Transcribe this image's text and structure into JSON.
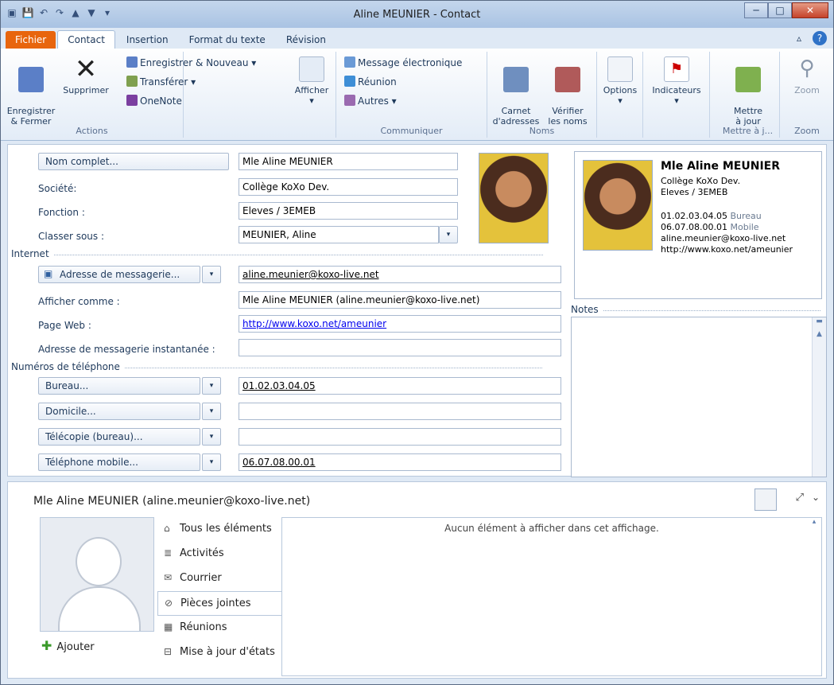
{
  "window": {
    "title": "Aline MEUNIER  -  Contact"
  },
  "tabs": [
    "Fichier",
    "Contact",
    "Insertion",
    "Format du texte",
    "Révision"
  ],
  "ribbon": {
    "actions": {
      "save_close": "Enregistrer\n& Fermer",
      "delete": "Supprimer",
      "save_new": "Enregistrer & Nouveau ▾",
      "forward": "Transférer ▾",
      "onenote": "OneNote",
      "label": "Actions"
    },
    "show": {
      "label": "Afficher"
    },
    "communicate": {
      "email": "Message électronique",
      "meeting": "Réunion",
      "more": "Autres ▾",
      "label": "Communiquer"
    },
    "names": {
      "address_book": "Carnet\nd'adresses",
      "check_names": "Vérifier\nles noms",
      "label": "Noms"
    },
    "options": {
      "label": "Options"
    },
    "flags": {
      "label": "Indicateurs"
    },
    "update": {
      "button": "Mettre\nà jour",
      "label": "Mettre à j..."
    },
    "zoom": {
      "button": "Zoom",
      "label": "Zoom"
    }
  },
  "form": {
    "fullname_btn": "Nom complet...",
    "fullname": "Mle Aline MEUNIER",
    "company_lbl": "Société:",
    "company": "Collège KoXo Dev.",
    "job_lbl": "Fonction :",
    "job": "Eleves / 3EMEB",
    "fileas_lbl": "Classer sous :",
    "fileas": "MEUNIER, Aline",
    "internet": "Internet",
    "email_btn": "Adresse de messagerie...",
    "email": "aline.meunier@koxo-live.net",
    "display_lbl": "Afficher comme :",
    "display": "Mle Aline MEUNIER (aline.meunier@koxo-live.net)",
    "web_lbl": "Page Web :",
    "web": "http://www.koxo.net/ameunier",
    "im_lbl": "Adresse de messagerie instantanée :",
    "im": "",
    "phones": "Numéros de téléphone",
    "business_btn": "Bureau...",
    "business": "01.02.03.04.05",
    "home_btn": "Domicile...",
    "home": "",
    "fax_btn": "Télécopie (bureau)...",
    "fax": "",
    "mobile_btn": "Téléphone mobile...",
    "mobile": "06.07.08.00.01",
    "notes": "Notes"
  },
  "card": {
    "name": "Mle Aline MEUNIER",
    "company": "Collège KoXo Dev.",
    "job": "Eleves / 3EMEB",
    "phone1": "01.02.03.04.05",
    "phone1_type": "Bureau",
    "phone2": "06.07.08.00.01",
    "phone2_type": "Mobile",
    "email": "aline.meunier@koxo-live.net",
    "web": "http://www.koxo.net/ameunier"
  },
  "people_pane": {
    "title": "Mle Aline MEUNIER (aline.meunier@koxo-live.net)",
    "tabs": [
      "Tous les éléments",
      "Activités",
      "Courrier",
      "Pièces jointes",
      "Réunions",
      "Mise à jour d'états"
    ],
    "empty": "Aucun élément à afficher dans cet affichage.",
    "add": "Ajouter"
  }
}
